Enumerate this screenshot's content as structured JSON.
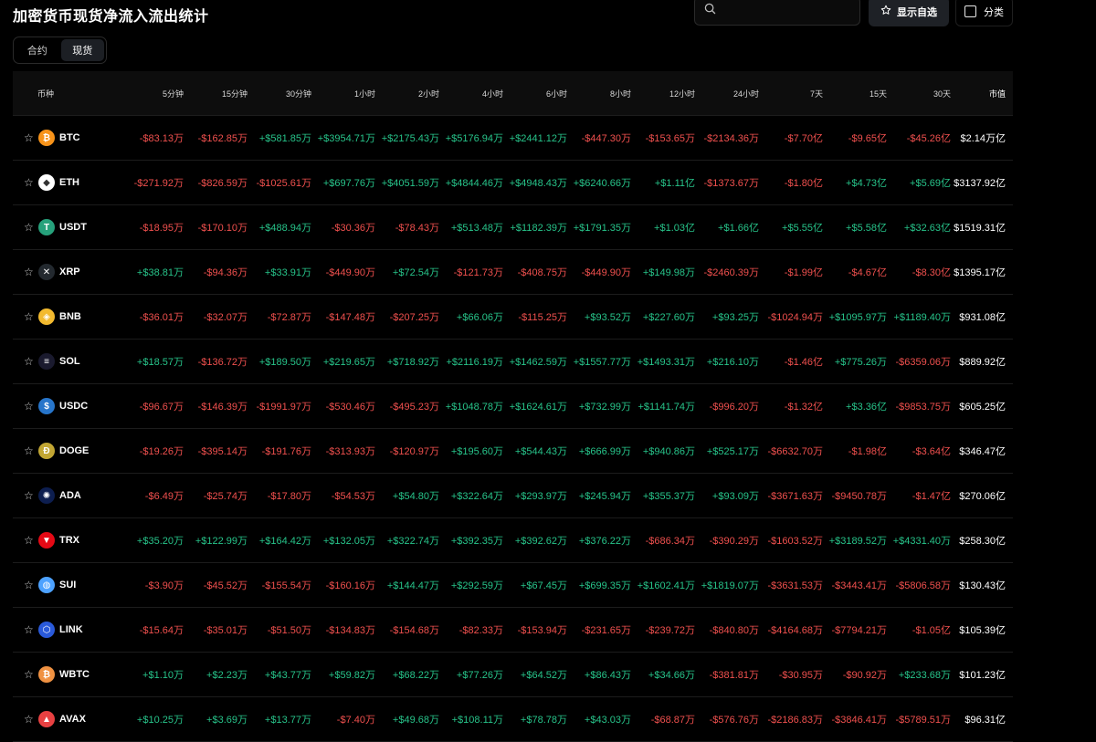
{
  "title": "加密货币现货净流入流出统计",
  "search": {
    "placeholder": ""
  },
  "watchlist_label": "显示自选",
  "category_label": "分类",
  "tabs": [
    {
      "label": "合约",
      "active": false
    },
    {
      "label": "现货",
      "active": true
    }
  ],
  "columns": [
    "币种",
    "5分钟",
    "15分钟",
    "30分钟",
    "1小时",
    "2小时",
    "4小时",
    "6小时",
    "8小时",
    "12小时",
    "24小时",
    "7天",
    "15天",
    "30天",
    "市值"
  ],
  "colors": {
    "positive": "#27c48a",
    "negative": "#f0504e"
  },
  "rows": [
    {
      "symbol": "BTC",
      "icon": "bitcoin-icon",
      "icon_color": "#f7931a",
      "glyph": "₿",
      "values": [
        "-$83.13万",
        "-$162.85万",
        "+$581.85万",
        "+$3954.71万",
        "+$2175.43万",
        "+$5176.94万",
        "+$2441.12万",
        "-$447.30万",
        "-$153.65万",
        "-$2134.36万",
        "-$7.70亿",
        "-$9.65亿",
        "-$45.26亿"
      ],
      "market_cap": "$2.14万亿"
    },
    {
      "symbol": "ETH",
      "icon": "ethereum-icon",
      "icon_color": "#ffffff",
      "glyph": "◆",
      "values": [
        "-$271.92万",
        "-$826.59万",
        "-$1025.61万",
        "+$697.76万",
        "+$4051.59万",
        "+$4844.46万",
        "+$4948.43万",
        "+$6240.66万",
        "+$1.11亿",
        "-$1373.67万",
        "-$1.80亿",
        "+$4.73亿",
        "+$5.69亿"
      ],
      "market_cap": "$3137.92亿"
    },
    {
      "symbol": "USDT",
      "icon": "tether-icon",
      "icon_color": "#26a17b",
      "glyph": "T",
      "values": [
        "-$18.95万",
        "-$170.10万",
        "+$488.94万",
        "-$30.36万",
        "-$78.43万",
        "+$513.48万",
        "+$1182.39万",
        "+$1791.35万",
        "+$1.03亿",
        "+$1.66亿",
        "+$5.55亿",
        "+$5.58亿",
        "+$32.63亿"
      ],
      "market_cap": "$1519.31亿"
    },
    {
      "symbol": "XRP",
      "icon": "xrp-icon",
      "icon_color": "#23292f",
      "glyph": "✕",
      "values": [
        "+$38.81万",
        "-$94.36万",
        "+$33.91万",
        "-$449.90万",
        "+$72.54万",
        "-$121.73万",
        "-$408.75万",
        "-$449.90万",
        "+$149.98万",
        "-$2460.39万",
        "-$1.99亿",
        "-$4.67亿",
        "-$8.30亿"
      ],
      "market_cap": "$1395.17亿"
    },
    {
      "symbol": "BNB",
      "icon": "bnb-icon",
      "icon_color": "#f3ba2f",
      "glyph": "◈",
      "values": [
        "-$36.01万",
        "-$32.07万",
        "-$72.87万",
        "-$147.48万",
        "-$207.25万",
        "+$66.06万",
        "-$115.25万",
        "+$93.52万",
        "+$227.60万",
        "+$93.25万",
        "-$1024.94万",
        "+$1095.97万",
        "+$1189.40万"
      ],
      "market_cap": "$931.08亿"
    },
    {
      "symbol": "SOL",
      "icon": "solana-icon",
      "icon_color": "#1a1a2e",
      "glyph": "≡",
      "values": [
        "+$18.57万",
        "-$136.72万",
        "+$189.50万",
        "+$219.65万",
        "+$718.92万",
        "+$2116.19万",
        "+$1462.59万",
        "+$1557.77万",
        "+$1493.31万",
        "+$216.10万",
        "-$1.46亿",
        "+$775.26万",
        "-$6359.06万"
      ],
      "market_cap": "$889.92亿"
    },
    {
      "symbol": "USDC",
      "icon": "usdc-icon",
      "icon_color": "#2775ca",
      "glyph": "$",
      "values": [
        "-$96.67万",
        "-$146.39万",
        "-$1991.97万",
        "-$530.46万",
        "-$495.23万",
        "+$1048.78万",
        "+$1624.61万",
        "+$732.99万",
        "+$1141.74万",
        "-$996.20万",
        "-$1.32亿",
        "+$3.36亿",
        "-$9853.75万"
      ],
      "market_cap": "$605.25亿"
    },
    {
      "symbol": "DOGE",
      "icon": "doge-icon",
      "icon_color": "#c2a633",
      "glyph": "Ð",
      "values": [
        "-$19.26万",
        "-$395.14万",
        "-$191.76万",
        "-$313.93万",
        "-$120.97万",
        "+$195.60万",
        "+$544.43万",
        "+$666.99万",
        "+$940.86万",
        "+$525.17万",
        "-$6632.70万",
        "-$1.98亿",
        "-$3.64亿"
      ],
      "market_cap": "$346.47亿"
    },
    {
      "symbol": "ADA",
      "icon": "cardano-icon",
      "icon_color": "#0d1e4f",
      "glyph": "✺",
      "values": [
        "-$6.49万",
        "-$25.74万",
        "-$17.80万",
        "-$54.53万",
        "+$54.80万",
        "+$322.64万",
        "+$293.97万",
        "+$245.94万",
        "+$355.37万",
        "+$93.09万",
        "-$3671.63万",
        "-$9450.78万",
        "-$1.47亿"
      ],
      "market_cap": "$270.06亿"
    },
    {
      "symbol": "TRX",
      "icon": "tron-icon",
      "icon_color": "#e50915",
      "glyph": "▼",
      "values": [
        "+$35.20万",
        "+$122.99万",
        "+$164.42万",
        "+$132.05万",
        "+$322.74万",
        "+$392.35万",
        "+$392.62万",
        "+$376.22万",
        "-$686.34万",
        "-$390.29万",
        "-$1603.52万",
        "+$3189.52万",
        "+$4331.40万"
      ],
      "market_cap": "$258.30亿"
    },
    {
      "symbol": "SUI",
      "icon": "sui-icon",
      "icon_color": "#4da2ff",
      "glyph": "◍",
      "values": [
        "-$3.90万",
        "-$45.52万",
        "-$155.54万",
        "-$160.16万",
        "+$144.47万",
        "+$292.59万",
        "+$67.45万",
        "+$699.35万",
        "+$1602.41万",
        "+$1819.07万",
        "-$3631.53万",
        "-$3443.41万",
        "-$5806.58万"
      ],
      "market_cap": "$130.43亿"
    },
    {
      "symbol": "LINK",
      "icon": "chainlink-icon",
      "icon_color": "#2a5ada",
      "glyph": "⬡",
      "values": [
        "-$15.64万",
        "-$35.01万",
        "-$51.50万",
        "-$134.83万",
        "-$154.68万",
        "-$82.33万",
        "-$153.94万",
        "-$231.65万",
        "-$239.72万",
        "-$840.80万",
        "-$4164.68万",
        "-$7794.21万",
        "-$1.05亿"
      ],
      "market_cap": "$105.39亿"
    },
    {
      "symbol": "WBTC",
      "icon": "wbtc-icon",
      "icon_color": "#f09242",
      "glyph": "₿",
      "values": [
        "+$1.10万",
        "+$2.23万",
        "+$43.77万",
        "+$59.82万",
        "+$68.22万",
        "+$77.26万",
        "+$64.52万",
        "+$86.43万",
        "+$34.66万",
        "-$381.81万",
        "-$30.95万",
        "-$90.92万",
        "+$233.68万"
      ],
      "market_cap": "$101.23亿"
    },
    {
      "symbol": "AVAX",
      "icon": "avalanche-icon",
      "icon_color": "#e84142",
      "glyph": "▲",
      "values": [
        "+$10.25万",
        "+$3.69万",
        "+$13.77万",
        "-$7.40万",
        "+$49.68万",
        "+$108.11万",
        "+$78.78万",
        "+$43.03万",
        "-$68.87万",
        "-$576.76万",
        "-$2186.83万",
        "-$3846.41万",
        "-$5789.51万"
      ],
      "market_cap": "$96.31亿"
    }
  ]
}
